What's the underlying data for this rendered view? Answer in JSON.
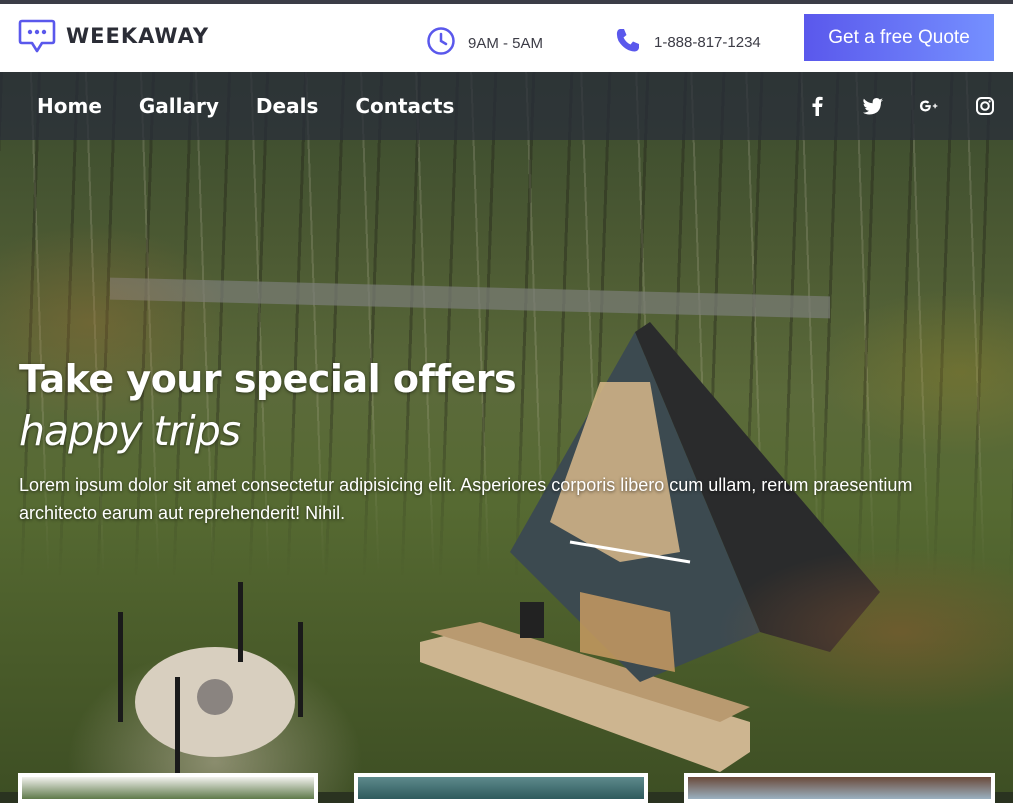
{
  "brand": {
    "name": "WEEKAWAY",
    "logo_icon": "chat-bubble-icon",
    "accent": "#5a58ec"
  },
  "topbar": {
    "hours": {
      "icon": "clock-icon",
      "text": "9AM - 5AM"
    },
    "phone": {
      "icon": "phone-icon",
      "text": "1-888-817-1234"
    },
    "cta_label": "Get a free Quote"
  },
  "nav": {
    "items": [
      {
        "label": "Home"
      },
      {
        "label": "Gallary"
      },
      {
        "label": "Deals"
      },
      {
        "label": "Contacts"
      }
    ],
    "social": [
      "facebook-icon",
      "twitter-icon",
      "google-plus-icon",
      "instagram-icon"
    ]
  },
  "hero": {
    "headline": "Take your special offers",
    "subhead": "happy trips",
    "body": "Lorem ipsum dolor sit amet consectetur adipisicing elit. Asperiores corporis libero cum ullam, rerum praesentium architecto earum aut reprehenderit! Nihil."
  }
}
